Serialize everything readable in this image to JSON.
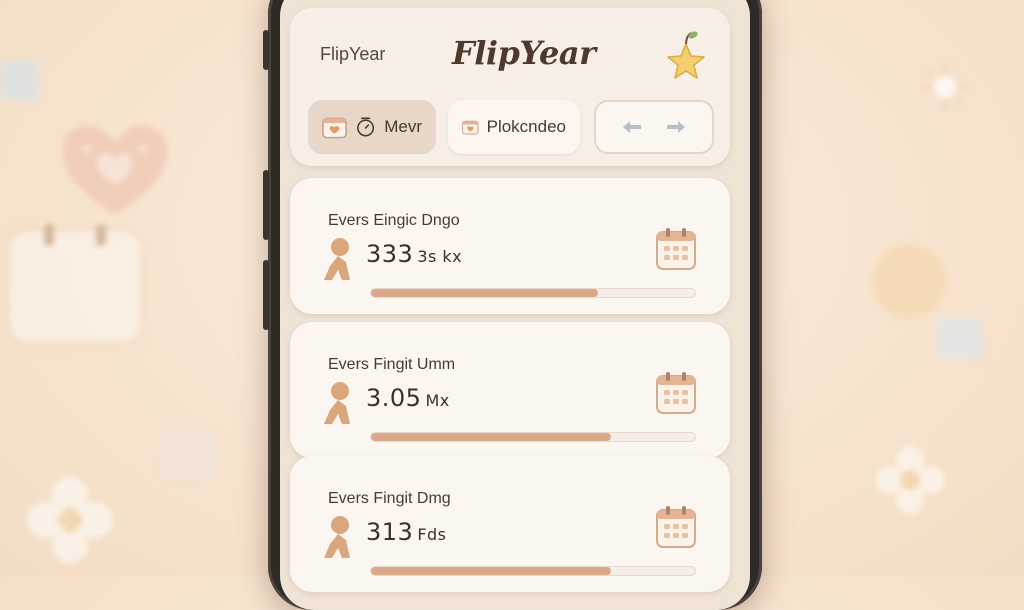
{
  "app": {
    "name_small": "FlipYear",
    "name_script": "FlipYear"
  },
  "tabs": [
    {
      "label": "Mevr",
      "icons": [
        "heart-calendar-icon",
        "timer-icon"
      ]
    },
    {
      "label": "Plokcndeo",
      "icons": [
        "heart-calendar-icon"
      ]
    },
    {
      "label": "",
      "icons": [
        "left-arrow-icon",
        "right-arrow-icon"
      ]
    }
  ],
  "cards": [
    {
      "title": "Evers Eingic Dngo",
      "value": "333",
      "unit": "3s kx",
      "progress": 0.7
    },
    {
      "title": "Evers Fingit Umm",
      "value": "3.05",
      "unit": "Mx",
      "progress": 0.74
    },
    {
      "title": "Evers Fingit Dmg",
      "value": "313",
      "unit": "Fds",
      "progress": 0.74
    }
  ],
  "colors": {
    "accent": "#d9a88a",
    "card_bg": "#fbf6f0",
    "text": "#4a3a2e",
    "background": "#f7e4cf"
  }
}
